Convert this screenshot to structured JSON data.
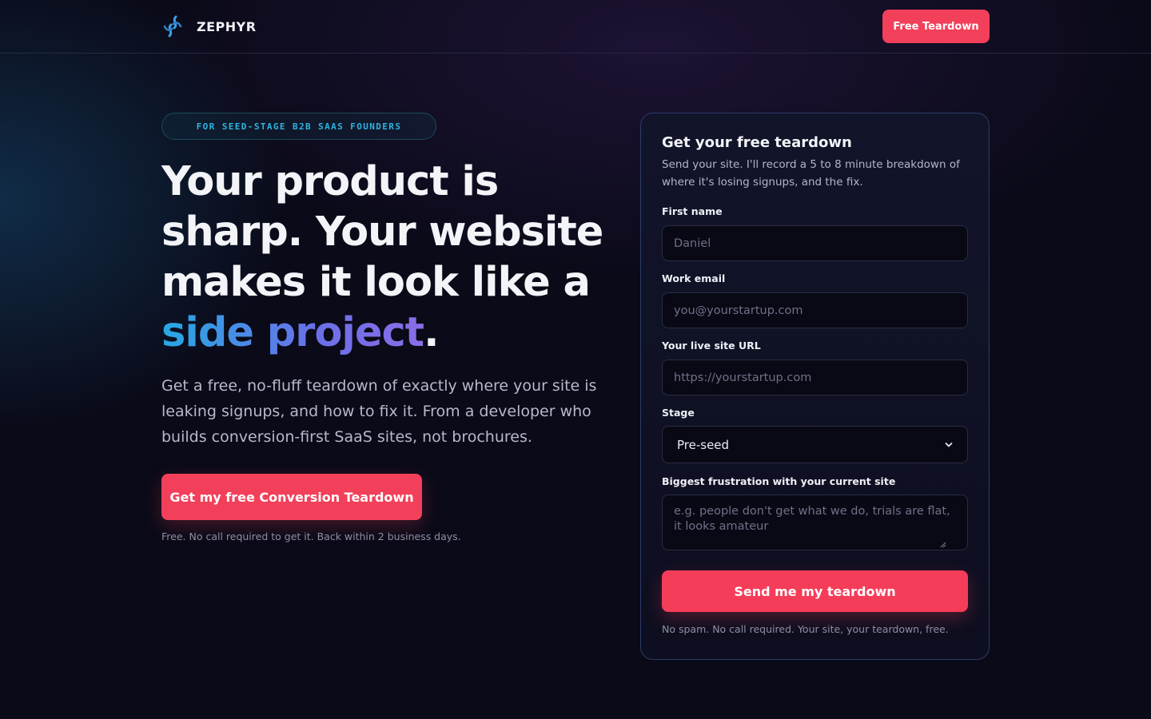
{
  "header": {
    "brand": "ZEPHYR",
    "cta_label": "Free Teardown"
  },
  "hero": {
    "badge": "FOR SEED-STAGE B2B SAAS FOUNDERS",
    "title_lines": [
      "Your product is",
      "sharp. Your website",
      "makes it look like a"
    ],
    "title_accent": "side project",
    "title_end": ".",
    "subtitle": "Get a free, no-fluff teardown of exactly where your site is leaking signups, and how to fix it. From a developer who builds conversion-first SaaS sites, not brochures.",
    "cta_label": "Get my free Conversion Teardown",
    "note": "Free. No call required to get it. Back within 2 business days."
  },
  "form": {
    "title": "Get your free teardown",
    "subtitle": "Send your site. I'll record a 5 to 8 minute breakdown of where it's losing signups, and the fix.",
    "first_name": {
      "label": "First name",
      "placeholder": "Daniel",
      "value": ""
    },
    "email": {
      "label": "Work email",
      "placeholder": "you@yourstartup.com",
      "value": ""
    },
    "site_url": {
      "label": "Your live site URL",
      "placeholder": "https://yourstartup.com",
      "value": ""
    },
    "stage": {
      "label": "Stage",
      "selected": "Pre-seed"
    },
    "frustration": {
      "label": "Biggest frustration with your current site",
      "placeholder": "e.g. people don't get what we do, trials are flat, it looks amateur"
    },
    "submit_label": "Send me my teardown",
    "note": "No spam. No call required. Your site, your teardown, free."
  },
  "colors": {
    "background": "#0a0a18",
    "accent": "#f2405a",
    "badge_text": "#2fb3e0",
    "gradient_start": "#27a8e3",
    "gradient_end": "#8a6ee6"
  },
  "icons": {
    "logo": "zephyr-swirl-logo",
    "select": "chevron-down-icon"
  }
}
